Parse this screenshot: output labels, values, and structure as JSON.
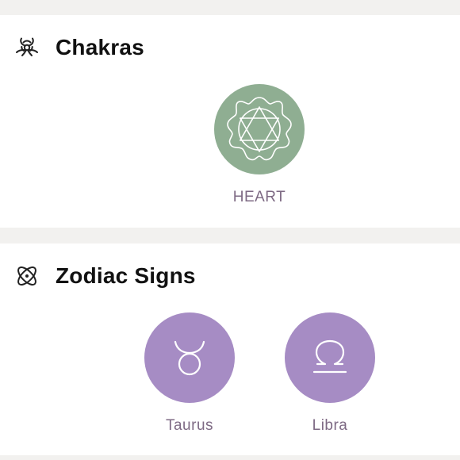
{
  "sections": {
    "chakras": {
      "title": "Chakras",
      "icon": "chakras-icon",
      "items": [
        {
          "label": "HEART",
          "icon": "heart-chakra-icon",
          "color": "#8fae92"
        }
      ]
    },
    "zodiac": {
      "title": "Zodiac Signs",
      "icon": "atom-icon",
      "items": [
        {
          "label": "Taurus",
          "icon": "taurus-icon",
          "color": "#a68cc4"
        },
        {
          "label": "Libra",
          "icon": "libra-icon",
          "color": "#a68cc4"
        }
      ]
    }
  },
  "colors": {
    "background": "#f2f1ef",
    "card": "#ffffff",
    "label": "#7e6a84",
    "title": "#111111"
  }
}
